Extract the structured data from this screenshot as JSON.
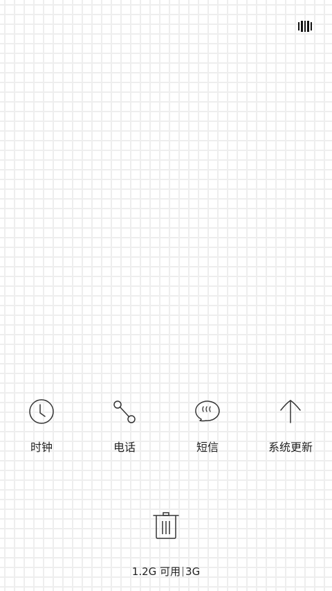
{
  "status": {
    "top_icon": "recent-apps-icon"
  },
  "apps": [
    {
      "label": "时钟",
      "icon": "clock-icon"
    },
    {
      "label": "电话",
      "icon": "phone-icon"
    },
    {
      "label": "短信",
      "icon": "message-icon"
    },
    {
      "label": "系统更新",
      "icon": "arrow-up-icon"
    }
  ],
  "memory": {
    "available": "1.2G 可用",
    "total": "3G"
  },
  "controls": {
    "clear_icon": "trash-icon"
  },
  "colors": {
    "icon_stroke": "#333333",
    "text": "#222222",
    "grid_line": "#eeeeee",
    "background": "#ffffff"
  }
}
